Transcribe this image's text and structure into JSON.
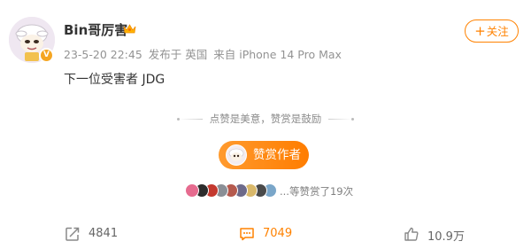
{
  "post": {
    "username": "Bin哥厉害",
    "meta": {
      "timestamp": "23-5-20 22:45",
      "location": "发布于 英国",
      "source": "来自 iPhone 14 Pro Max"
    },
    "follow_label": "关注",
    "text": "下一位受害者 JDG"
  },
  "reward": {
    "slogan": "点赞是美意，赞赏是鼓励",
    "button_label": "赞赏作者",
    "supporters_summary": "...等赞赏了19次",
    "supporter_colors": [
      "#e66b8f",
      "#2c2c2c",
      "#c4392f",
      "#8a8f96",
      "#b55a4e",
      "#6d6a8a",
      "#d9b86a",
      "#4a4a4a",
      "#7aa6c9"
    ]
  },
  "actions": {
    "repost_count": "4841",
    "comment_count": "7049",
    "like_count": "10.9万"
  },
  "colors": {
    "accent": "#ff8200",
    "meta_text": "#939393"
  }
}
